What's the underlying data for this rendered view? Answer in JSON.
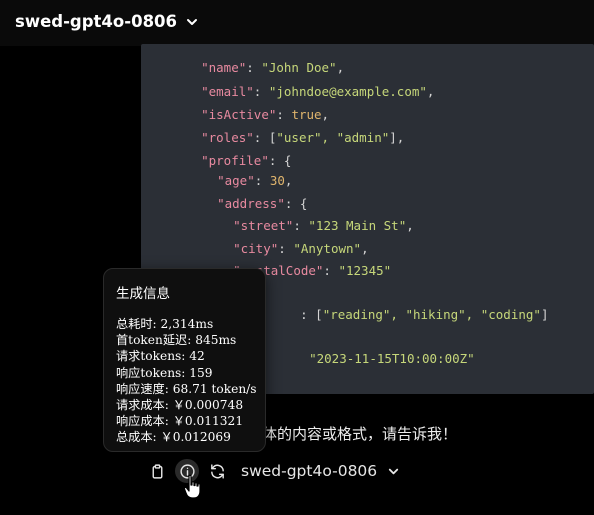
{
  "header": {
    "model_name": "swed-gpt4o-0806",
    "dropdown_icon": "chevron-down-icon"
  },
  "code": {
    "lines": [
      {
        "key": "\"name\"",
        "sep": ": ",
        "val": "\"John Doe\"",
        "end": ","
      },
      {
        "key": "\"email\"",
        "sep": ": ",
        "val": "\"johndoe@example.com\"",
        "end": ","
      },
      {
        "key": "\"isActive\"",
        "sep": ": ",
        "val": "true",
        "end": ","
      },
      {
        "key": "\"roles\"",
        "sep": ": [",
        "val": "\"user\", \"admin\"",
        "end": "],"
      },
      {
        "key": "\"profile\"",
        "sep": ": {",
        "val": "",
        "end": ""
      },
      {
        "key": "\"age\"",
        "sep": ": ",
        "val": "30",
        "end": ","
      },
      {
        "key": "\"address\"",
        "sep": ": {",
        "val": "",
        "end": ""
      },
      {
        "key": "\"street\"",
        "sep": ": ",
        "val": "\"123 Main St\"",
        "end": ","
      },
      {
        "key": "\"city\"",
        "sep": ": ",
        "val": "\"Anytown\"",
        "end": ","
      },
      {
        "key": "\"postalCode\"",
        "sep": ": ",
        "val": "\"12345\"",
        "end": ""
      },
      {
        "key": "",
        "sep": ": [",
        "val": "\"reading\", \"hiking\", \"coding\"",
        "end": "]"
      },
      {
        "key": "",
        "sep": "",
        "val": "\"2023-11-15T10:00:00Z\"",
        "end": ""
      }
    ]
  },
  "reply": {
    "visible_text": "体的内容或格式，请告诉我！"
  },
  "tooltip": {
    "title": "生成信息",
    "rows": [
      "总耗时: 2,314ms",
      "首token延迟: 845ms",
      "请求tokens: 42",
      "响应tokens: 159",
      "响应速度: 68.71 token/s",
      "请求成本: ￥0.000748",
      "响应成本: ￥0.011321",
      "总成本: ￥0.012069"
    ]
  },
  "actions": {
    "copy_icon": "clipboard-icon",
    "info_icon": "info-icon",
    "regenerate_icon": "refresh-icon",
    "model_label": "swed-gpt4o-0806"
  }
}
